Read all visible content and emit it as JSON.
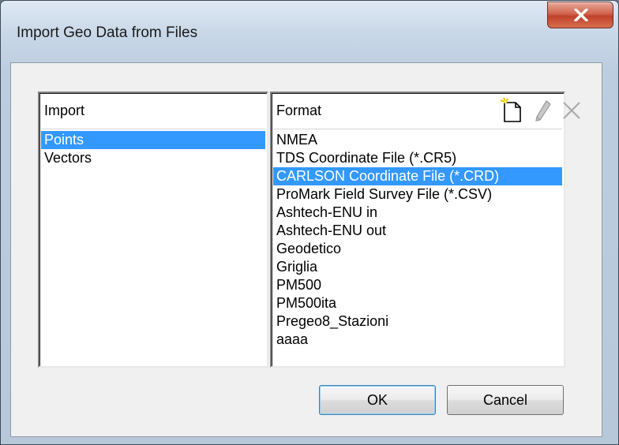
{
  "window": {
    "title": "Import Geo Data from Files"
  },
  "import_panel": {
    "header": "Import",
    "items": [
      "Points",
      "Vectors"
    ],
    "selected_index": 0
  },
  "format_panel": {
    "header": "Format",
    "toolbar": {
      "new_icon": "new-file-icon",
      "edit_icon": "pencil-icon",
      "delete_icon": "delete-x-icon"
    },
    "items": [
      "NMEA",
      "TDS Coordinate File (*.CR5)",
      "CARLSON Coordinate File (*.CRD)",
      "ProMark Field Survey File (*.CSV)",
      "Ashtech-ENU in",
      "Ashtech-ENU out",
      "Geodetico",
      "Griglia",
      "PM500",
      "PM500ita",
      "Pregeo8_Stazioni",
      "aaaa"
    ],
    "selected_index": 2
  },
  "buttons": {
    "ok": "OK",
    "cancel": "Cancel"
  },
  "colors": {
    "selection": "#3399ff",
    "close_button": "#c0412b"
  }
}
